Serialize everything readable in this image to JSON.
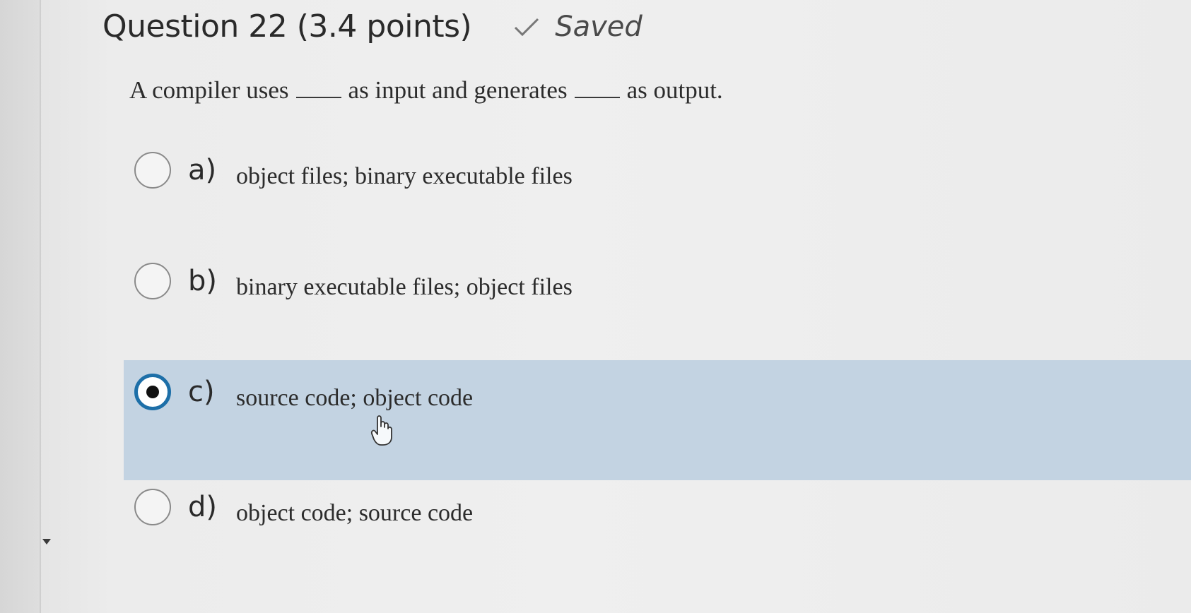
{
  "question": {
    "title": "Question 22 (3.4 points)",
    "saved_label": "Saved",
    "prompt_part1": "A compiler uses",
    "prompt_part2": "as input and generates",
    "prompt_part3": "as output."
  },
  "options": [
    {
      "letter": "a)",
      "text": "object files; binary executable files",
      "selected": false
    },
    {
      "letter": "b)",
      "text": "binary executable files; object files",
      "selected": false
    },
    {
      "letter": "c)",
      "text": "source code; object code",
      "selected": true
    },
    {
      "letter": "d)",
      "text": "object code; source code",
      "selected": false
    }
  ],
  "icons": {
    "saved": "checkmark-icon",
    "cursor": "hand-pointer-icon",
    "scroll": "caret-down-icon"
  },
  "colors": {
    "selected_row": "#c3d3e2",
    "selected_radio": "#1d6fa8"
  }
}
